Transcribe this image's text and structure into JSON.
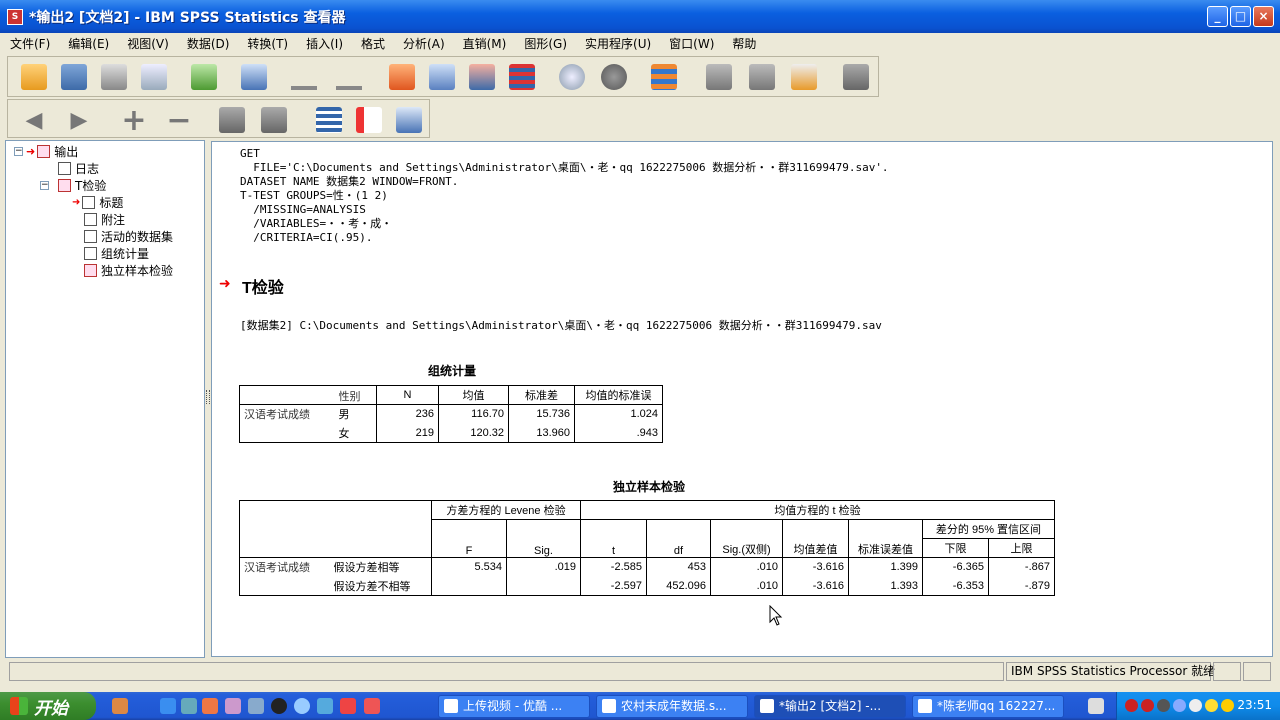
{
  "window": {
    "title": "*输出2 [文档2] - IBM SPSS Statistics 查看器",
    "min": "_",
    "max": "□",
    "close": "×"
  },
  "menu": [
    "文件(F)",
    "编辑(E)",
    "视图(V)",
    "数据(D)",
    "转换(T)",
    "插入(I)",
    "格式",
    "分析(A)",
    "直销(M)",
    "图形(G)",
    "实用程序(U)",
    "窗口(W)",
    "帮助"
  ],
  "toolbar_glyphs": {
    "back": "◀",
    "forward": "▶",
    "expand": "+",
    "collapse": "−"
  },
  "tree": {
    "root": "输出",
    "log": "日志",
    "ttest": "T检验",
    "items": [
      "标题",
      "附注",
      "活动的数据集",
      "组统计量",
      "独立样本检验"
    ]
  },
  "syntax": [
    "GET",
    "  FILE='C:\\Documents and Settings\\Administrator\\桌面\\・老・qq 1622275006 数据分析・・群311699479.sav'.",
    "DATASET NAME 数据集2 WINDOW=FRONT.",
    "T-TEST GROUPS=性・(1 2)",
    "  /MISSING=ANALYSIS",
    "  /VARIABLES=・・考・成・",
    "  /CRITERIA=CI(.95)."
  ],
  "section_title": "T检验",
  "dataset_line": "[数据集2] C:\\Documents and Settings\\Administrator\\桌面\\・老・qq 1622275006 数据分析・・群311699479.sav",
  "group_stats": {
    "title": "组统计量",
    "header": {
      "group_var": "性别",
      "n": "N",
      "mean": "均值",
      "sd": "标准差",
      "se": "均值的标准误"
    },
    "var_label": "汉语考试成绩",
    "rows": [
      {
        "group": "男",
        "n": "236",
        "mean": "116.70",
        "sd": "15.736",
        "se": "1.024"
      },
      {
        "group": "女",
        "n": "219",
        "mean": "120.32",
        "sd": "13.960",
        "se": ".943"
      }
    ]
  },
  "ind_test": {
    "title": "独立样本检验",
    "levene_header": "方差方程的 Levene 检验",
    "ttest_header": "均值方程的 t 检验",
    "ci_header": "差分的 95% 置信区间",
    "cols": {
      "F": "F",
      "sig": "Sig.",
      "t": "t",
      "df": "df",
      "sig2": "Sig.(双侧)",
      "md": "均值差值",
      "sed": "标准误差值",
      "lower": "下限",
      "upper": "上限"
    },
    "var_label": "汉语考试成绩",
    "rows": [
      {
        "label": "假设方差相等",
        "F": "5.534",
        "sig": ".019",
        "t": "-2.585",
        "df": "453",
        "sig2": ".010",
        "md": "-3.616",
        "sed": "1.399",
        "lower": "-6.365",
        "upper": "-.867"
      },
      {
        "label": "假设方差不相等",
        "F": "",
        "sig": "",
        "t": "-2.597",
        "df": "452.096",
        "sig2": ".010",
        "md": "-3.616",
        "sed": "1.393",
        "lower": "-6.353",
        "upper": "-.879"
      }
    ]
  },
  "status": {
    "processor": "IBM SPSS Statistics Processor 就绪"
  },
  "taskbar": {
    "start": "开始",
    "tasks": [
      "上传视频 - 优酷 ...",
      "农村未成年数据.s...",
      "*输出2 [文档2] -...",
      "*陈老师qq 162227..."
    ],
    "clock": "23:51"
  }
}
